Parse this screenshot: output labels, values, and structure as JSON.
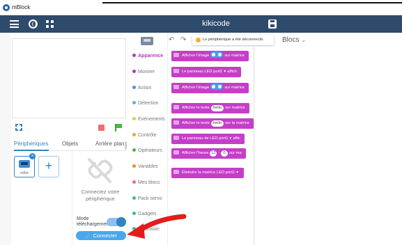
{
  "window": {
    "title": "mBlock"
  },
  "appbar": {
    "project_title": "kikicode"
  },
  "stage_panel": {
    "tabs": [
      {
        "label": "Périphériques",
        "active": true
      },
      {
        "label": "Objets",
        "active": false
      },
      {
        "label": "Arrière plan",
        "active": false
      }
    ],
    "device": {
      "name": "mBot"
    },
    "add_symbol": "+",
    "connect_prompt": "Connectez votre périphérique",
    "mode_label": "Mode téléchargement",
    "mode_enabled": true,
    "connect_button": "Connecter"
  },
  "categories": [
    {
      "label": "Apparence",
      "color": "#b536c3",
      "active": true
    },
    {
      "label": "Montrer",
      "color": "#b536c3",
      "active": false
    },
    {
      "label": "Action",
      "color": "#4a8fe0",
      "active": false
    },
    {
      "label": "Détection",
      "color": "#4cb8e8",
      "active": false
    },
    {
      "label": "Evénements",
      "color": "#f2c431",
      "active": false
    },
    {
      "label": "Contrôle",
      "color": "#f5a623",
      "active": false
    },
    {
      "label": "Opérateurs",
      "color": "#46b946",
      "active": false
    },
    {
      "label": "Variables",
      "color": "#f58a2a",
      "active": false
    },
    {
      "label": "Mes blocs",
      "color": "#f26d6d",
      "active": false
    },
    {
      "label": "Pack servo",
      "color": "#3fb7a2",
      "active": false
    },
    {
      "label": "Gadgets",
      "color": "#3fb7a2",
      "active": false
    },
    {
      "label": "Extension",
      "color": "#3fb7a2",
      "active": false
    }
  ],
  "toolbar": {
    "undo_icon": "↶",
    "redo_icon": "↷",
    "toast": "Le périphérique a été déconnecté.",
    "blocs_label": "Blocs",
    "chevron": "⌄"
  },
  "blocks": {
    "b1_text": "Afficher l'image",
    "b1_suffix": "sur matrice",
    "b2_text": "Le panneau LED",
    "b2_port": "port1",
    "b2_suffix": "affich",
    "b3_text": "Afficher l'image",
    "b3_suffix": "sur matrice",
    "b4_text": "Afficher le texte",
    "b4_value": "hello",
    "b4_suffix": "sur matrice",
    "b5_text": "Afficher le texte",
    "b5_value": "hello",
    "b5_suffix": "sur la matrice",
    "b6_text": "Le panneau de LED",
    "b6_port": "port1",
    "b6_suffix": "affic",
    "b7_text": "Afficher l'heure",
    "b7_h": "12",
    "b7_sep": ":",
    "b7_m": "0",
    "b7_suffix": "sur ma",
    "b8_text": "Éteindre la matrice LED",
    "b8_port": "port1",
    "dropdown_arrow": "▾"
  }
}
